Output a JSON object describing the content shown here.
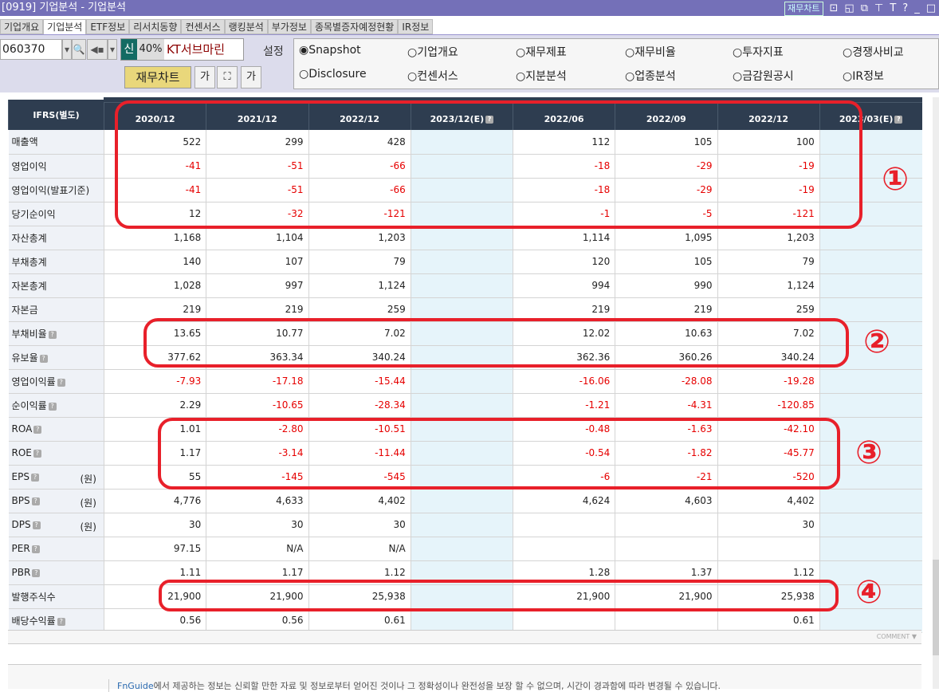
{
  "window": {
    "title": "[0919] 기업분석 - 기업분석",
    "chart_button": "재무차트",
    "icons": [
      "chart-icon",
      "layout-icon",
      "window-icon",
      "pin-icon",
      "font-icon",
      "help-icon",
      "minimize-icon",
      "maximize-icon"
    ]
  },
  "tabs": [
    {
      "label": "기업개요"
    },
    {
      "label": "기업분석",
      "active": true
    },
    {
      "label": "ETF정보"
    },
    {
      "label": "리서치동향"
    },
    {
      "label": "컨센서스"
    },
    {
      "label": "랭킹분석"
    },
    {
      "label": "부가정보"
    },
    {
      "label": "종목별증자예정현황"
    },
    {
      "label": "IR정보"
    }
  ],
  "toolbar": {
    "code": "060370",
    "stock_badge": "신",
    "margin": "40%",
    "stock_name": "KT서브마린",
    "setting": "설정",
    "fin_chart": "재무차트",
    "font_down": "가",
    "fit": "⛶",
    "font_up": "가"
  },
  "radios": [
    {
      "label": "Snapshot",
      "checked": true
    },
    {
      "label": "기업개요"
    },
    {
      "label": "재무제표"
    },
    {
      "label": "재무비율"
    },
    {
      "label": "투자지표"
    },
    {
      "label": "경쟁사비교"
    },
    {
      "label": "Disclosure"
    },
    {
      "label": "컨센서스"
    },
    {
      "label": "지분분석"
    },
    {
      "label": "업종분석"
    },
    {
      "label": "금감원공시"
    },
    {
      "label": "IR정보"
    }
  ],
  "table": {
    "corner": "IFRS(별도)",
    "columns": [
      "2020/12",
      "2021/12",
      "2022/12",
      "2023/12(E)",
      "2022/06",
      "2022/09",
      "2022/12",
      "2023/03(E)"
    ],
    "estimate_columns": [
      3,
      7
    ],
    "rows": [
      {
        "label": "매출액",
        "values": [
          "522",
          "299",
          "428",
          "",
          "112",
          "105",
          "100",
          ""
        ]
      },
      {
        "label": "영업이익",
        "values": [
          "-41",
          "-51",
          "-66",
          "",
          "-18",
          "-29",
          "-19",
          ""
        ]
      },
      {
        "label": "영업이익(발표기준)",
        "values": [
          "-41",
          "-51",
          "-66",
          "",
          "-18",
          "-29",
          "-19",
          ""
        ]
      },
      {
        "label": "당기순이익",
        "values": [
          "12",
          "-32",
          "-121",
          "",
          "-1",
          "-5",
          "-121",
          ""
        ]
      },
      {
        "label": "자산총계",
        "values": [
          "1,168",
          "1,104",
          "1,203",
          "",
          "1,114",
          "1,095",
          "1,203",
          ""
        ]
      },
      {
        "label": "부채총계",
        "values": [
          "140",
          "107",
          "79",
          "",
          "120",
          "105",
          "79",
          ""
        ]
      },
      {
        "label": "자본총계",
        "values": [
          "1,028",
          "997",
          "1,124",
          "",
          "994",
          "990",
          "1,124",
          ""
        ]
      },
      {
        "label": "자본금",
        "values": [
          "219",
          "219",
          "259",
          "",
          "219",
          "219",
          "259",
          ""
        ]
      },
      {
        "label": "부채비율",
        "help": true,
        "values": [
          "13.65",
          "10.77",
          "7.02",
          "",
          "12.02",
          "10.63",
          "7.02",
          ""
        ]
      },
      {
        "label": "유보율",
        "help": true,
        "values": [
          "377.62",
          "363.34",
          "340.24",
          "",
          "362.36",
          "360.26",
          "340.24",
          ""
        ]
      },
      {
        "label": "영업이익률",
        "help": true,
        "values": [
          "-7.93",
          "-17.18",
          "-15.44",
          "",
          "-16.06",
          "-28.08",
          "-19.28",
          ""
        ]
      },
      {
        "label": "순이익률",
        "help": true,
        "values": [
          "2.29",
          "-10.65",
          "-28.34",
          "",
          "-1.21",
          "-4.31",
          "-120.85",
          ""
        ]
      },
      {
        "label": "ROA",
        "help": true,
        "values": [
          "1.01",
          "-2.80",
          "-10.51",
          "",
          "-0.48",
          "-1.63",
          "-42.10",
          ""
        ]
      },
      {
        "label": "ROE",
        "help": true,
        "values": [
          "1.17",
          "-3.14",
          "-11.44",
          "",
          "-0.54",
          "-1.82",
          "-45.77",
          ""
        ]
      },
      {
        "label": "EPS",
        "help": true,
        "unit": "(원)",
        "values": [
          "55",
          "-145",
          "-545",
          "",
          "-6",
          "-21",
          "-520",
          ""
        ]
      },
      {
        "label": "BPS",
        "help": true,
        "unit": "(원)",
        "values": [
          "4,776",
          "4,633",
          "4,402",
          "",
          "4,624",
          "4,603",
          "4,402",
          ""
        ]
      },
      {
        "label": "DPS",
        "help": true,
        "unit": "(원)",
        "values": [
          "30",
          "30",
          "30",
          "",
          "",
          "",
          "30",
          ""
        ]
      },
      {
        "label": "PER",
        "help": true,
        "values": [
          "97.15",
          "N/A",
          "N/A",
          "",
          "",
          "",
          "",
          ""
        ]
      },
      {
        "label": "PBR",
        "help": true,
        "values": [
          "1.11",
          "1.17",
          "1.12",
          "",
          "1.28",
          "1.37",
          "1.12",
          ""
        ]
      },
      {
        "label": "발행주식수",
        "values": [
          "21,900",
          "21,900",
          "25,938",
          "",
          "21,900",
          "21,900",
          "25,938",
          ""
        ]
      },
      {
        "label": "배당수익률",
        "help": true,
        "values": [
          "0.56",
          "0.56",
          "0.61",
          "",
          "",
          "",
          "0.61",
          ""
        ]
      }
    ]
  },
  "comment": "COMMENT ▼",
  "footer": {
    "brand": "FnGuide",
    "text": "에서 제공하는 정보는 신뢰할 만한 자료 및 정보로부터 얻어진 것이나 그 정확성이나 완전성을 보장 할 수 없으며, 시간이 경과함에 따라 변경될 수 있습니다."
  },
  "annotations": {
    "color": "#e8202a",
    "labels": [
      "①",
      "②",
      "③",
      "④"
    ]
  },
  "colors": {
    "title_bar": "#7470b8",
    "header": "#2e3d50",
    "negative": "#e60000",
    "estimate_bg": "#e6f4fa"
  }
}
